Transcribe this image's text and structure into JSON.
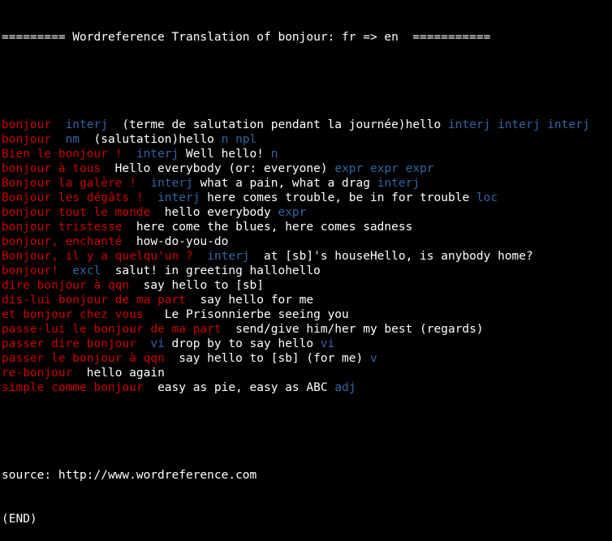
{
  "header": "========= Wordreference Translation of bonjour: fr => en  ===========",
  "colors": {
    "background": "#000000",
    "french_term": "#cc0000",
    "translation": "#ffffff",
    "part_of_speech": "#3465a4"
  },
  "entries": [
    {
      "segments": [
        {
          "text": "bonjour",
          "style": "fr"
        },
        {
          "text": "  interj",
          "style": "pos"
        },
        {
          "text": "  (terme de salutation pendant la journée)hello ",
          "style": "en"
        },
        {
          "text": "interj interj interj",
          "style": "pos"
        }
      ]
    },
    {
      "segments": [
        {
          "text": "bonjour",
          "style": "fr"
        },
        {
          "text": "  nm",
          "style": "pos"
        },
        {
          "text": "  (salutation)hello ",
          "style": "en"
        },
        {
          "text": "n npl",
          "style": "pos"
        }
      ]
    },
    {
      "segments": [
        {
          "text": "Bien le bonjour !",
          "style": "fr"
        },
        {
          "text": "  interj",
          "style": "pos"
        },
        {
          "text": " Well hello! ",
          "style": "en"
        },
        {
          "text": "n",
          "style": "pos"
        }
      ]
    },
    {
      "segments": [
        {
          "text": "bonjour à tous",
          "style": "fr"
        },
        {
          "text": "  Hello everybody (or: everyone) ",
          "style": "en"
        },
        {
          "text": "expr expr expr",
          "style": "pos"
        }
      ]
    },
    {
      "segments": [
        {
          "text": "Bonjour la galère !",
          "style": "fr"
        },
        {
          "text": "  interj",
          "style": "pos"
        },
        {
          "text": " what a pain, what a drag ",
          "style": "en"
        },
        {
          "text": "interj",
          "style": "pos"
        }
      ]
    },
    {
      "segments": [
        {
          "text": "Bonjour les dégâts !",
          "style": "fr"
        },
        {
          "text": "  interj",
          "style": "pos"
        },
        {
          "text": " here comes trouble, be in for trouble ",
          "style": "en"
        },
        {
          "text": "loc",
          "style": "pos"
        }
      ]
    },
    {
      "segments": [
        {
          "text": "bonjour tout le monde",
          "style": "fr"
        },
        {
          "text": "  hello everybody ",
          "style": "en"
        },
        {
          "text": "expr",
          "style": "pos"
        }
      ]
    },
    {
      "segments": [
        {
          "text": "bonjour tristesse",
          "style": "fr"
        },
        {
          "text": "  here come the blues, here comes sadness",
          "style": "en"
        }
      ]
    },
    {
      "segments": [
        {
          "text": "bonjour, enchanté",
          "style": "fr"
        },
        {
          "text": "  how-do-you-do",
          "style": "en"
        }
      ]
    },
    {
      "segments": [
        {
          "text": "Bonjour, il y a quelqu'un ?",
          "style": "fr"
        },
        {
          "text": "  interj",
          "style": "pos"
        },
        {
          "text": "  at [sb]'s houseHello, is anybody home?",
          "style": "en"
        }
      ]
    },
    {
      "segments": [
        {
          "text": "bonjour!",
          "style": "fr"
        },
        {
          "text": "  excl",
          "style": "pos"
        },
        {
          "text": "  salut! in greeting hallohello",
          "style": "en"
        }
      ]
    },
    {
      "segments": [
        {
          "text": "dire bonjour à qqn",
          "style": "fr"
        },
        {
          "text": "  say hello to [sb]",
          "style": "en"
        }
      ]
    },
    {
      "segments": [
        {
          "text": "dis-lui bonjour de ma part",
          "style": "fr"
        },
        {
          "text": "  say hello for me",
          "style": "en"
        }
      ]
    },
    {
      "segments": [
        {
          "text": "et bonjour chez vous",
          "style": "fr"
        },
        {
          "text": "   Le Prisonnierbe seeing you",
          "style": "en"
        }
      ]
    },
    {
      "segments": [
        {
          "text": "passe-lui le bonjour de ma part",
          "style": "fr"
        },
        {
          "text": "  send/give him/her my best (regards)",
          "style": "en"
        }
      ]
    },
    {
      "segments": [
        {
          "text": "passer dire bonjour",
          "style": "fr"
        },
        {
          "text": "  vi",
          "style": "pos"
        },
        {
          "text": " drop by to say hello ",
          "style": "en"
        },
        {
          "text": "vi",
          "style": "pos"
        }
      ]
    },
    {
      "segments": [
        {
          "text": "passer le bonjour à qqn",
          "style": "fr"
        },
        {
          "text": "  say hello to [sb] (for me) ",
          "style": "en"
        },
        {
          "text": "v",
          "style": "pos"
        }
      ]
    },
    {
      "segments": [
        {
          "text": "re-bonjour",
          "style": "fr"
        },
        {
          "text": "  hello again",
          "style": "en"
        }
      ]
    },
    {
      "segments": [
        {
          "text": "simple comme bonjour",
          "style": "fr"
        },
        {
          "text": "  easy as pie, easy as ABC ",
          "style": "en"
        },
        {
          "text": "adj",
          "style": "pos"
        }
      ]
    }
  ],
  "source_line": "source: http://www.wordreference.com",
  "end_line": "(END)"
}
